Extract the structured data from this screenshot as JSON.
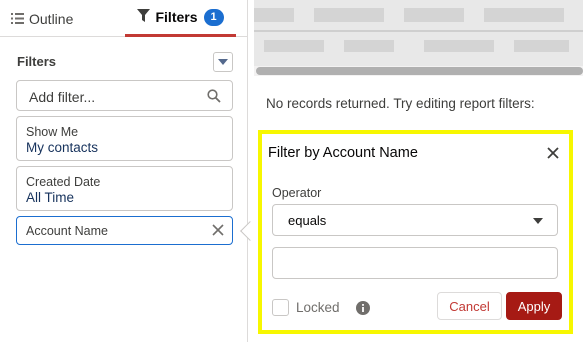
{
  "tabs": [
    {
      "label": "Outline",
      "icon": "list-icon",
      "active": false
    },
    {
      "label": "Filters",
      "icon": "funnel-icon",
      "active": true,
      "badge": "1"
    }
  ],
  "filters_panel": {
    "heading": "Filters",
    "search_placeholder": "Add filter...",
    "cards": [
      {
        "label": "Show Me",
        "value": "My contacts"
      },
      {
        "label": "Created Date",
        "value": "All Time"
      },
      {
        "label": "Account Name",
        "value": ""
      }
    ]
  },
  "report": {
    "no_records_text": "No records returned. Try editing report filters:"
  },
  "popover": {
    "title": "Filter by Account Name",
    "operator_label": "Operator",
    "operator_value": "equals",
    "value_input": "",
    "locked_label": "Locked",
    "locked_checked": false,
    "cancel_label": "Cancel",
    "apply_label": "Apply"
  },
  "colors": {
    "accent_blue": "#1b6ed0",
    "active_tab_underline": "#c23934",
    "apply_button": "#a61a14",
    "highlight_border": "#f7f700"
  }
}
